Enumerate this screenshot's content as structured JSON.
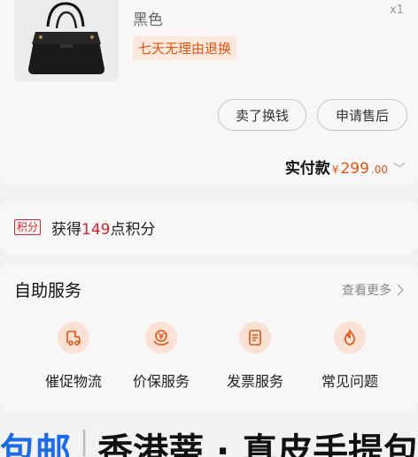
{
  "order_item": {
    "variant": "黑色",
    "quantity": "x1",
    "tag": "七天无理由退换"
  },
  "actions": {
    "sell_label": "卖了换钱",
    "aftersale_label": "申请售后"
  },
  "payment": {
    "label": "实付款",
    "currency": "¥",
    "amount_int": "299",
    "amount_dec": ".00"
  },
  "points": {
    "badge": "积分",
    "prefix": "获得",
    "number": "149",
    "suffix": "点积分"
  },
  "self_service": {
    "title": "自助服务",
    "more": "查看更多",
    "items": [
      {
        "label": "催促物流",
        "icon": "logistics-icon"
      },
      {
        "label": "价保服务",
        "icon": "price-protect-icon"
      },
      {
        "label": "发票服务",
        "icon": "invoice-icon"
      },
      {
        "label": "常见问题",
        "icon": "faq-icon"
      }
    ]
  },
  "banner": {
    "part1": "包邮",
    "separator": "|",
    "part2": "香港蒂 · 真皮手提包"
  },
  "colors": {
    "accent": "#e2540f",
    "points_red": "#d9232e",
    "banner_blue": "#1e6be8"
  }
}
